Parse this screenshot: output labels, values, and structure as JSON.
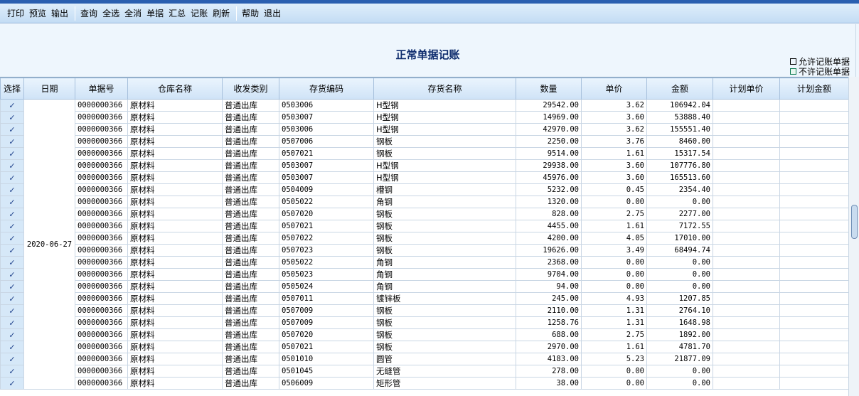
{
  "toolbar": {
    "group1": [
      "打印",
      "预览",
      "输出"
    ],
    "group2": [
      "查询",
      "全选",
      "全消",
      "单据",
      "汇总",
      "记账",
      "刷新"
    ],
    "group3": [
      "帮助",
      "退出"
    ]
  },
  "page_title": "正常单据记账",
  "legend": {
    "allowed": "允许记账单据",
    "not_allowed": "不许记账单据"
  },
  "columns": [
    "选择",
    "日期",
    "单据号",
    "仓库名称",
    "收发类别",
    "存货编码",
    "存货名称",
    "数量",
    "单价",
    "金额",
    "计划单价",
    "计划金额"
  ],
  "date": "2020-06-27",
  "check_mark": "✓",
  "rows": [
    [
      "0000000366",
      "原材料",
      "普通出库",
      "0503006",
      "H型钢",
      "29542.00",
      "3.62",
      "106942.04"
    ],
    [
      "0000000366",
      "原材料",
      "普通出库",
      "0503007",
      "H型钢",
      "14969.00",
      "3.60",
      "53888.40"
    ],
    [
      "0000000366",
      "原材料",
      "普通出库",
      "0503006",
      "H型钢",
      "42970.00",
      "3.62",
      "155551.40"
    ],
    [
      "0000000366",
      "原材料",
      "普通出库",
      "0507006",
      "钢板",
      "2250.00",
      "3.76",
      "8460.00"
    ],
    [
      "0000000366",
      "原材料",
      "普通出库",
      "0507021",
      "钢板",
      "9514.00",
      "1.61",
      "15317.54"
    ],
    [
      "0000000366",
      "原材料",
      "普通出库",
      "0503007",
      "H型钢",
      "29938.00",
      "3.60",
      "107776.80"
    ],
    [
      "0000000366",
      "原材料",
      "普通出库",
      "0503007",
      "H型钢",
      "45976.00",
      "3.60",
      "165513.60"
    ],
    [
      "0000000366",
      "原材料",
      "普通出库",
      "0504009",
      "槽钢",
      "5232.00",
      "0.45",
      "2354.40"
    ],
    [
      "0000000366",
      "原材料",
      "普通出库",
      "0505022",
      "角钢",
      "1320.00",
      "0.00",
      "0.00"
    ],
    [
      "0000000366",
      "原材料",
      "普通出库",
      "0507020",
      "钢板",
      "828.00",
      "2.75",
      "2277.00"
    ],
    [
      "0000000366",
      "原材料",
      "普通出库",
      "0507021",
      "钢板",
      "4455.00",
      "1.61",
      "7172.55"
    ],
    [
      "0000000366",
      "原材料",
      "普通出库",
      "0507022",
      "钢板",
      "4200.00",
      "4.05",
      "17010.00"
    ],
    [
      "0000000366",
      "原材料",
      "普通出库",
      "0507023",
      "钢板",
      "19626.00",
      "3.49",
      "68494.74"
    ],
    [
      "0000000366",
      "原材料",
      "普通出库",
      "0505022",
      "角钢",
      "2368.00",
      "0.00",
      "0.00"
    ],
    [
      "0000000366",
      "原材料",
      "普通出库",
      "0505023",
      "角钢",
      "9704.00",
      "0.00",
      "0.00"
    ],
    [
      "0000000366",
      "原材料",
      "普通出库",
      "0505024",
      "角钢",
      "94.00",
      "0.00",
      "0.00"
    ],
    [
      "0000000366",
      "原材料",
      "普通出库",
      "0507011",
      "镀锌板",
      "245.00",
      "4.93",
      "1207.85"
    ],
    [
      "0000000366",
      "原材料",
      "普通出库",
      "0507009",
      "钢板",
      "2110.00",
      "1.31",
      "2764.10"
    ],
    [
      "0000000366",
      "原材料",
      "普通出库",
      "0507009",
      "钢板",
      "1258.76",
      "1.31",
      "1648.98"
    ],
    [
      "0000000366",
      "原材料",
      "普通出库",
      "0507020",
      "钢板",
      "688.00",
      "2.75",
      "1892.00"
    ],
    [
      "0000000366",
      "原材料",
      "普通出库",
      "0507021",
      "钢板",
      "2970.00",
      "1.61",
      "4781.70"
    ],
    [
      "0000000366",
      "原材料",
      "普通出库",
      "0501010",
      "圆管",
      "4183.00",
      "5.23",
      "21877.09"
    ],
    [
      "0000000366",
      "原材料",
      "普通出库",
      "0501045",
      "无缝管",
      "278.00",
      "0.00",
      "0.00"
    ],
    [
      "0000000366",
      "原材料",
      "普通出库",
      "0506009",
      "矩形管",
      "38.00",
      "0.00",
      "0.00"
    ]
  ]
}
